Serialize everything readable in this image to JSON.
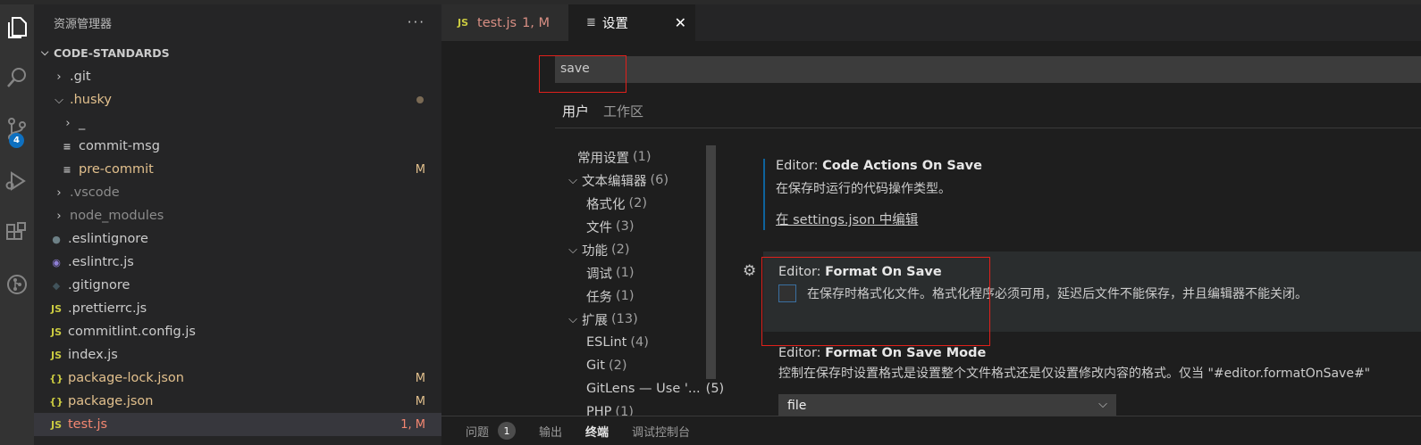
{
  "explorer": {
    "title": "资源管理器",
    "more": "···",
    "section": "CODE-STANDARDS",
    "items": [
      {
        "name": ".git",
        "status": "",
        "color": "#cccccc"
      },
      {
        "name": ".husky",
        "status": "",
        "color": "#e2c08d"
      },
      {
        "name": "_",
        "status": "",
        "color": "#cccccc"
      },
      {
        "name": "commit-msg",
        "status": "",
        "color": "#cccccc"
      },
      {
        "name": "pre-commit",
        "status": "M",
        "color": "#e2c08d"
      },
      {
        "name": ".vscode",
        "status": "",
        "color": "#8c8c8c"
      },
      {
        "name": "node_modules",
        "status": "",
        "color": "#8c8c8c"
      },
      {
        "name": ".eslintignore",
        "status": "",
        "color": "#cccccc"
      },
      {
        "name": ".eslintrc.js",
        "status": "",
        "color": "#cccccc"
      },
      {
        "name": ".gitignore",
        "status": "",
        "color": "#cccccc"
      },
      {
        "name": ".prettierrc.js",
        "status": "",
        "color": "#cccccc"
      },
      {
        "name": "commitlint.config.js",
        "status": "",
        "color": "#cccccc"
      },
      {
        "name": "index.js",
        "status": "",
        "color": "#cccccc"
      },
      {
        "name": "package-lock.json",
        "status": "M",
        "color": "#e2c08d"
      },
      {
        "name": "package.json",
        "status": "M",
        "color": "#e2c08d"
      },
      {
        "name": "test.js",
        "status": "1, M",
        "color": "#f48771"
      }
    ]
  },
  "activity": {
    "scm_badge": "4"
  },
  "tabs": {
    "tab1_icon": "JS",
    "tab1_label": "test.js",
    "tab1_status": "1, M",
    "tab2_label": "设置",
    "close": "✕"
  },
  "settings": {
    "search_value": "save",
    "scope_user": "用户",
    "scope_workspace": "工作区",
    "toc": [
      {
        "label": "常用设置",
        "count": "(1)"
      },
      {
        "label": "文本编辑器",
        "count": "(6)"
      },
      {
        "label": "格式化",
        "count": "(2)"
      },
      {
        "label": "文件",
        "count": "(3)"
      },
      {
        "label": "功能",
        "count": "(2)"
      },
      {
        "label": "调试",
        "count": "(1)"
      },
      {
        "label": "任务",
        "count": "(1)"
      },
      {
        "label": "扩展",
        "count": "(13)"
      },
      {
        "label": "ESLint",
        "count": "(4)"
      },
      {
        "label": "Git",
        "count": "(2)"
      },
      {
        "label": "GitLens — Use '...",
        "count": "(5)"
      },
      {
        "label": "PHP",
        "count": "(1)"
      }
    ],
    "code_actions": {
      "category": "Editor: ",
      "key": "Code Actions On Save",
      "desc": "在保存时运行的代码操作类型。",
      "link": "在 settings.json 中编辑"
    },
    "format_on_save": {
      "category": "Editor: ",
      "key": "Format On Save",
      "desc": "在保存时格式化文件。格式化程序必须可用，延迟后文件不能保存，并且编辑器不能关闭。"
    },
    "format_on_save_mode": {
      "category": "Editor: ",
      "key": "Format On Save Mode",
      "desc": "控制在保存时设置格式是设置整个文件格式还是仅设置修改内容的格式。仅当 \"#editor.formatOnSave#\"",
      "value": "file"
    }
  },
  "panel": {
    "problems": "问题",
    "problems_count": "1",
    "output": "输出",
    "terminal": "终端",
    "debug_console": "调试控制台"
  },
  "colors": {
    "accent": "#0e70c0",
    "highlight_box": "#e0201b"
  }
}
